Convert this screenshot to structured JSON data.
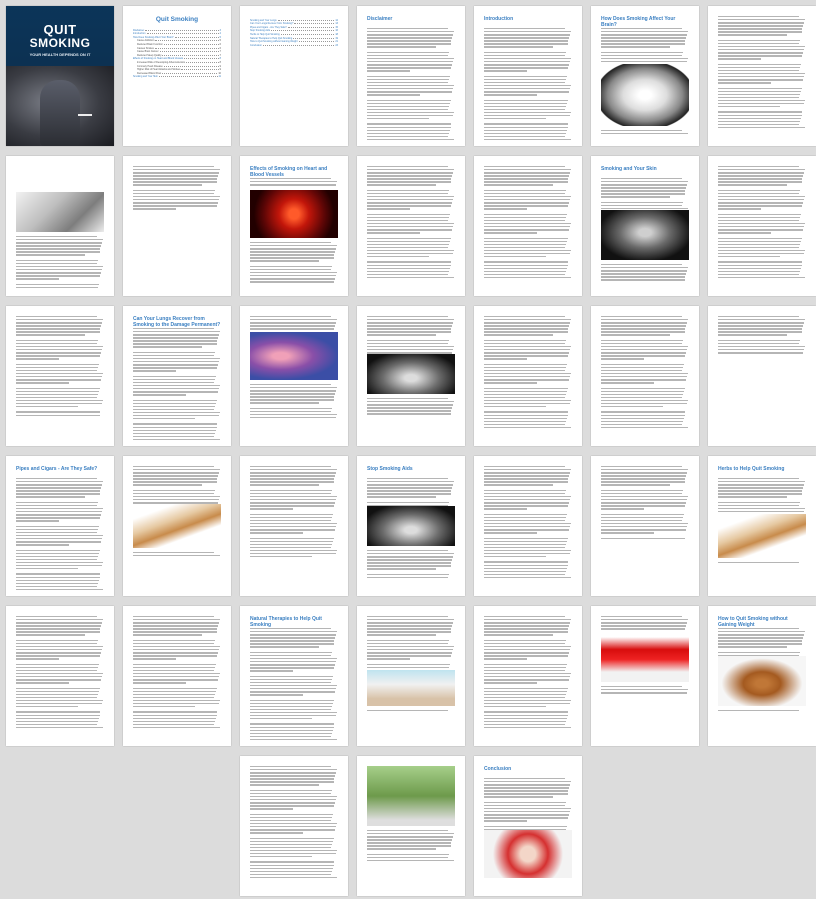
{
  "cover": {
    "title_line1": "QUIT",
    "title_line2": "SMOKING",
    "tagline": "YOUR HEALTH DEPENDS ON IT"
  },
  "toc": {
    "title": "Quit Smoking",
    "entries": [
      {
        "label": "Disclaimer",
        "page": "3",
        "level": 1
      },
      {
        "label": "Introduction",
        "page": "4",
        "level": 1
      },
      {
        "label": "How Does Smoking Affect Your Brain?",
        "page": "5",
        "level": 1
      },
      {
        "label": "Cause Addiction",
        "page": "5",
        "level": 2
      },
      {
        "label": "Reduced Brain Function",
        "page": "6",
        "level": 2
      },
      {
        "label": "Causes Strokes",
        "page": "6",
        "level": 2
      },
      {
        "label": "Cause Brain Cancer",
        "page": "7",
        "level": 2
      },
      {
        "label": "Reduced Sleep Quality",
        "page": "7",
        "level": 2
      },
      {
        "label": "Effects of Smoking on Heart and Blood Vessels",
        "page": "8",
        "level": 1
      },
      {
        "label": "Increased Risk of Developing Atherosclerosis",
        "page": "8",
        "level": 2
      },
      {
        "label": "Coronary Heart Disease",
        "page": "9",
        "level": 2
      },
      {
        "label": "Higher Risk of Heart Attacks and Strokes",
        "page": "9",
        "level": 2
      },
      {
        "label": "Decreased Blood Flow",
        "page": "10",
        "level": 2
      },
      {
        "label": "Smoking and Your Skin",
        "page": "11",
        "level": 1
      },
      {
        "label": "Smoking and Your Lungs",
        "page": "12",
        "level": 1
      },
      {
        "label": "Can Your Lungs Recover from Smoking?",
        "page": "13",
        "level": 1
      },
      {
        "label": "Pipes and Cigars - Are They Safe?",
        "page": "15",
        "level": 1
      },
      {
        "label": "Stop Smoking Aids",
        "page": "16",
        "level": 1
      },
      {
        "label": "Herbs to Help Quit Smoking",
        "page": "18",
        "level": 1
      },
      {
        "label": "Natural Therapies to Help Quit Smoking",
        "page": "19",
        "level": 1
      },
      {
        "label": "How to Quit Smoking without Gaining Weight",
        "page": "21",
        "level": 1
      },
      {
        "label": "Conclusion",
        "page": "23",
        "level": 1
      }
    ]
  },
  "pages": [
    {
      "title": "",
      "num": "2"
    },
    {
      "title": "Disclaimer",
      "num": "3"
    },
    {
      "title": "Introduction",
      "num": "4"
    },
    {
      "title": "How Does Smoking Affect Your Brain?",
      "num": "5"
    },
    {
      "title": "",
      "num": "6"
    },
    {
      "title": "",
      "num": "7"
    },
    {
      "title": "",
      "num": "8"
    },
    {
      "title": "Effects of Smoking on Heart and Blood Vessels",
      "num": "9"
    },
    {
      "title": "",
      "num": "10"
    },
    {
      "title": "",
      "num": "11"
    },
    {
      "title": "Smoking and Your Skin",
      "num": "12"
    },
    {
      "title": "",
      "num": "13"
    },
    {
      "title": "",
      "num": "14"
    },
    {
      "title": "Can Your Lungs Recover from Smoking to the Damage Permanent?",
      "num": "15"
    },
    {
      "title": "",
      "num": "16"
    },
    {
      "title": "",
      "num": "17"
    },
    {
      "title": "",
      "num": "18"
    },
    {
      "title": "",
      "num": "19"
    },
    {
      "title": "",
      "num": "20"
    },
    {
      "title": "Pipes and Cigars - Are They Safe?",
      "num": "21"
    },
    {
      "title": "",
      "num": "22"
    },
    {
      "title": "",
      "num": "23"
    },
    {
      "title": "Stop Smoking Aids",
      "num": "24"
    },
    {
      "title": "",
      "num": "25"
    },
    {
      "title": "",
      "num": "26"
    },
    {
      "title": "Herbs to Help Quit Smoking",
      "num": "27"
    },
    {
      "title": "",
      "num": "28"
    },
    {
      "title": "",
      "num": "29"
    },
    {
      "title": "Natural Therapies to Help Quit Smoking",
      "num": "30"
    },
    {
      "title": "",
      "num": "31"
    },
    {
      "title": "",
      "num": "32"
    },
    {
      "title": "",
      "num": "33"
    },
    {
      "title": "How to Quit Smoking without Gaining Weight",
      "num": "34"
    },
    {
      "title": "",
      "num": "35"
    },
    {
      "title": "",
      "num": "36"
    },
    {
      "title": "Conclusion",
      "num": "37"
    }
  ]
}
